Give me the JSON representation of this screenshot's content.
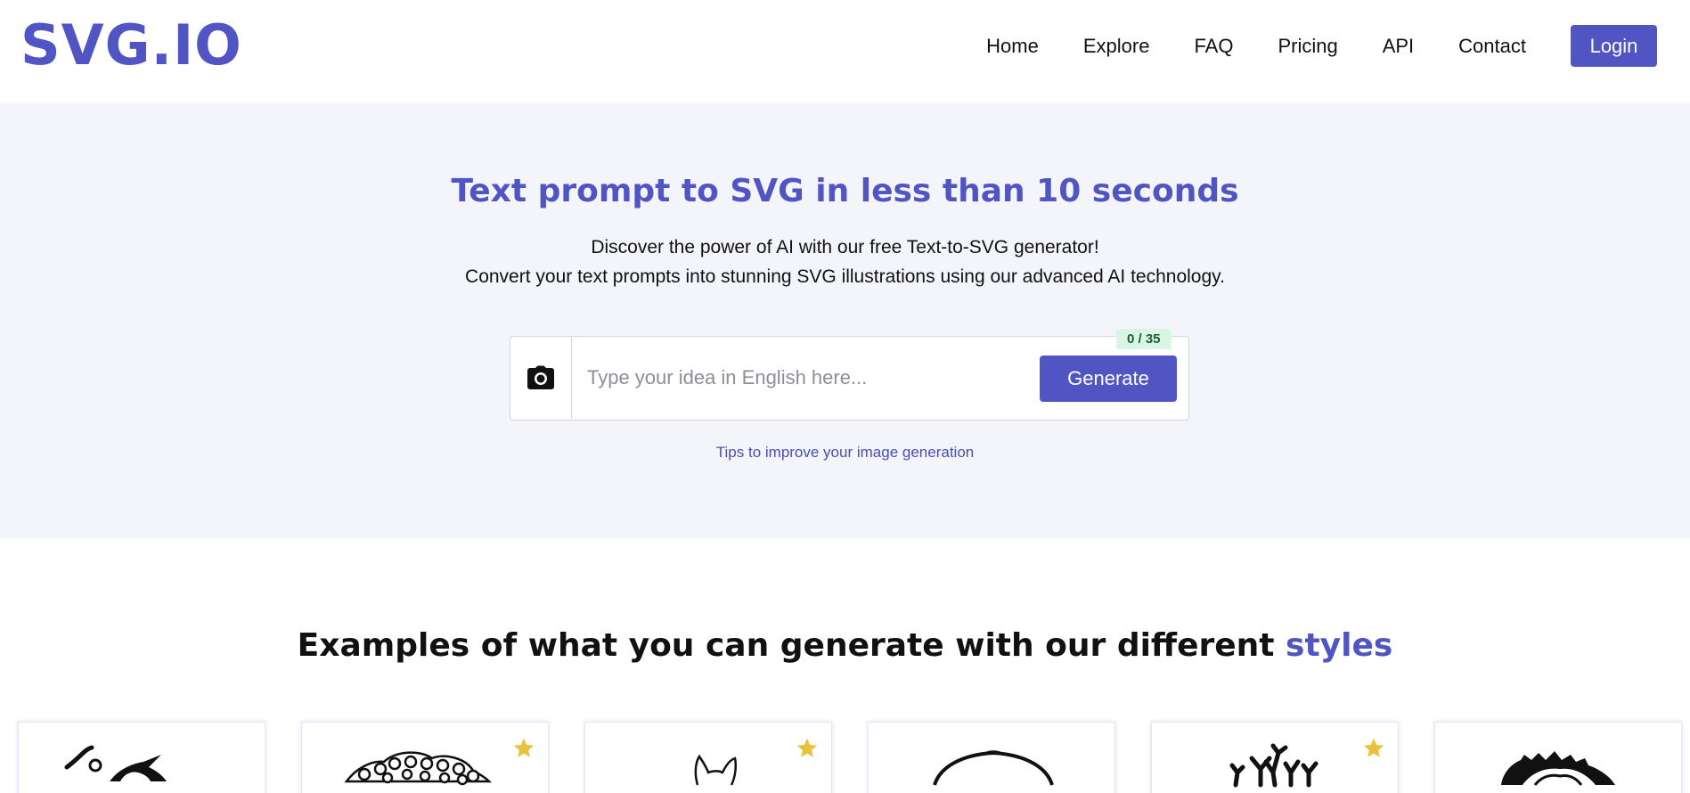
{
  "brand": {
    "logo": "SVG.IO",
    "accent_color": "#5155c4"
  },
  "nav": {
    "links": [
      "Home",
      "Explore",
      "FAQ",
      "Pricing",
      "API",
      "Contact"
    ],
    "login_label": "Login"
  },
  "hero": {
    "title": "Text prompt to SVG in less than 10 seconds",
    "subtitle_line1": "Discover the power of AI with our free Text-to-SVG generator!",
    "subtitle_line2": "Convert your text prompts into stunning SVG illustrations using our advanced AI technology.",
    "input_placeholder": "Type your idea in English here...",
    "input_value": "",
    "counter": "0 / 35",
    "generate_label": "Generate",
    "tips_link": "Tips to improve your image generation",
    "camera_icon": "camera-icon"
  },
  "examples": {
    "title_prefix": "Examples of what you can generate with our different ",
    "title_accent": "styles",
    "cards": [
      {
        "art": "witch-illustration",
        "starred": false
      },
      {
        "art": "flower-bush-illustration",
        "starred": true
      },
      {
        "art": "fox-outline-illustration",
        "starred": true
      },
      {
        "art": "round-object-illustration",
        "starred": false
      },
      {
        "art": "bare-tree-illustration",
        "starred": true
      },
      {
        "art": "furry-creature-illustration",
        "starred": false
      }
    ],
    "star_color": "#e7c23a"
  }
}
